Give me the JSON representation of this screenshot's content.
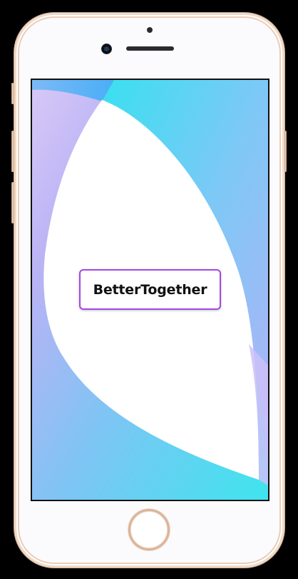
{
  "device": {
    "frame_color": "#f0d9c5",
    "body_color": "#fbfbfd"
  },
  "splash": {
    "app_name": "BetterTogether",
    "accent_color": "#a347e6",
    "gradient_colors": [
      "#5eb3f6",
      "#8ad0f6",
      "#bba5f6",
      "#3de8ec"
    ]
  }
}
